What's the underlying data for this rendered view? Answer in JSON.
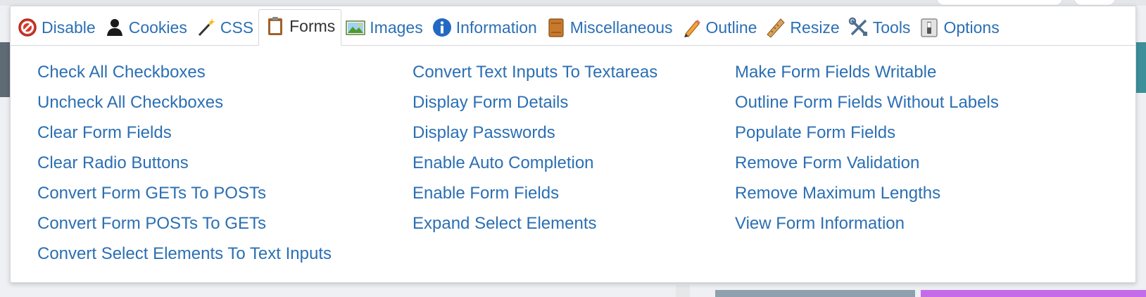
{
  "tabs": [
    {
      "label": "Disable",
      "icon": "disable-icon",
      "active": false
    },
    {
      "label": "Cookies",
      "icon": "cookies-icon",
      "active": false
    },
    {
      "label": "CSS",
      "icon": "css-wand-icon",
      "active": false
    },
    {
      "label": "Forms",
      "icon": "forms-clipboard-icon",
      "active": true
    },
    {
      "label": "Images",
      "icon": "images-icon",
      "active": false
    },
    {
      "label": "Information",
      "icon": "information-icon",
      "active": false
    },
    {
      "label": "Miscellaneous",
      "icon": "miscellaneous-icon",
      "active": false
    },
    {
      "label": "Outline",
      "icon": "outline-pencil-icon",
      "active": false
    },
    {
      "label": "Resize",
      "icon": "resize-ruler-icon",
      "active": false
    },
    {
      "label": "Tools",
      "icon": "tools-icon",
      "active": false
    },
    {
      "label": "Options",
      "icon": "options-switch-icon",
      "active": false
    }
  ],
  "menu": {
    "column1": [
      "Check All Checkboxes",
      "Uncheck All Checkboxes",
      "Clear Form Fields",
      "Clear Radio Buttons",
      "Convert Form GETs To POSTs",
      "Convert Form POSTs To GETs",
      "Convert Select Elements To Text Inputs"
    ],
    "column2": [
      "Convert Text Inputs To Textareas",
      "Display Form Details",
      "Display Passwords",
      "Enable Auto Completion",
      "Enable Form Fields",
      "Expand Select Elements"
    ],
    "column3": [
      "Make Form Fields Writable",
      "Outline Form Fields Without Labels",
      "Populate Form Fields",
      "Remove Form Validation",
      "Remove Maximum Lengths",
      "View Form Information"
    ]
  },
  "colors": {
    "link": "#2b6fb3",
    "active_tab_text": "#333333",
    "border": "#d4d6da"
  }
}
